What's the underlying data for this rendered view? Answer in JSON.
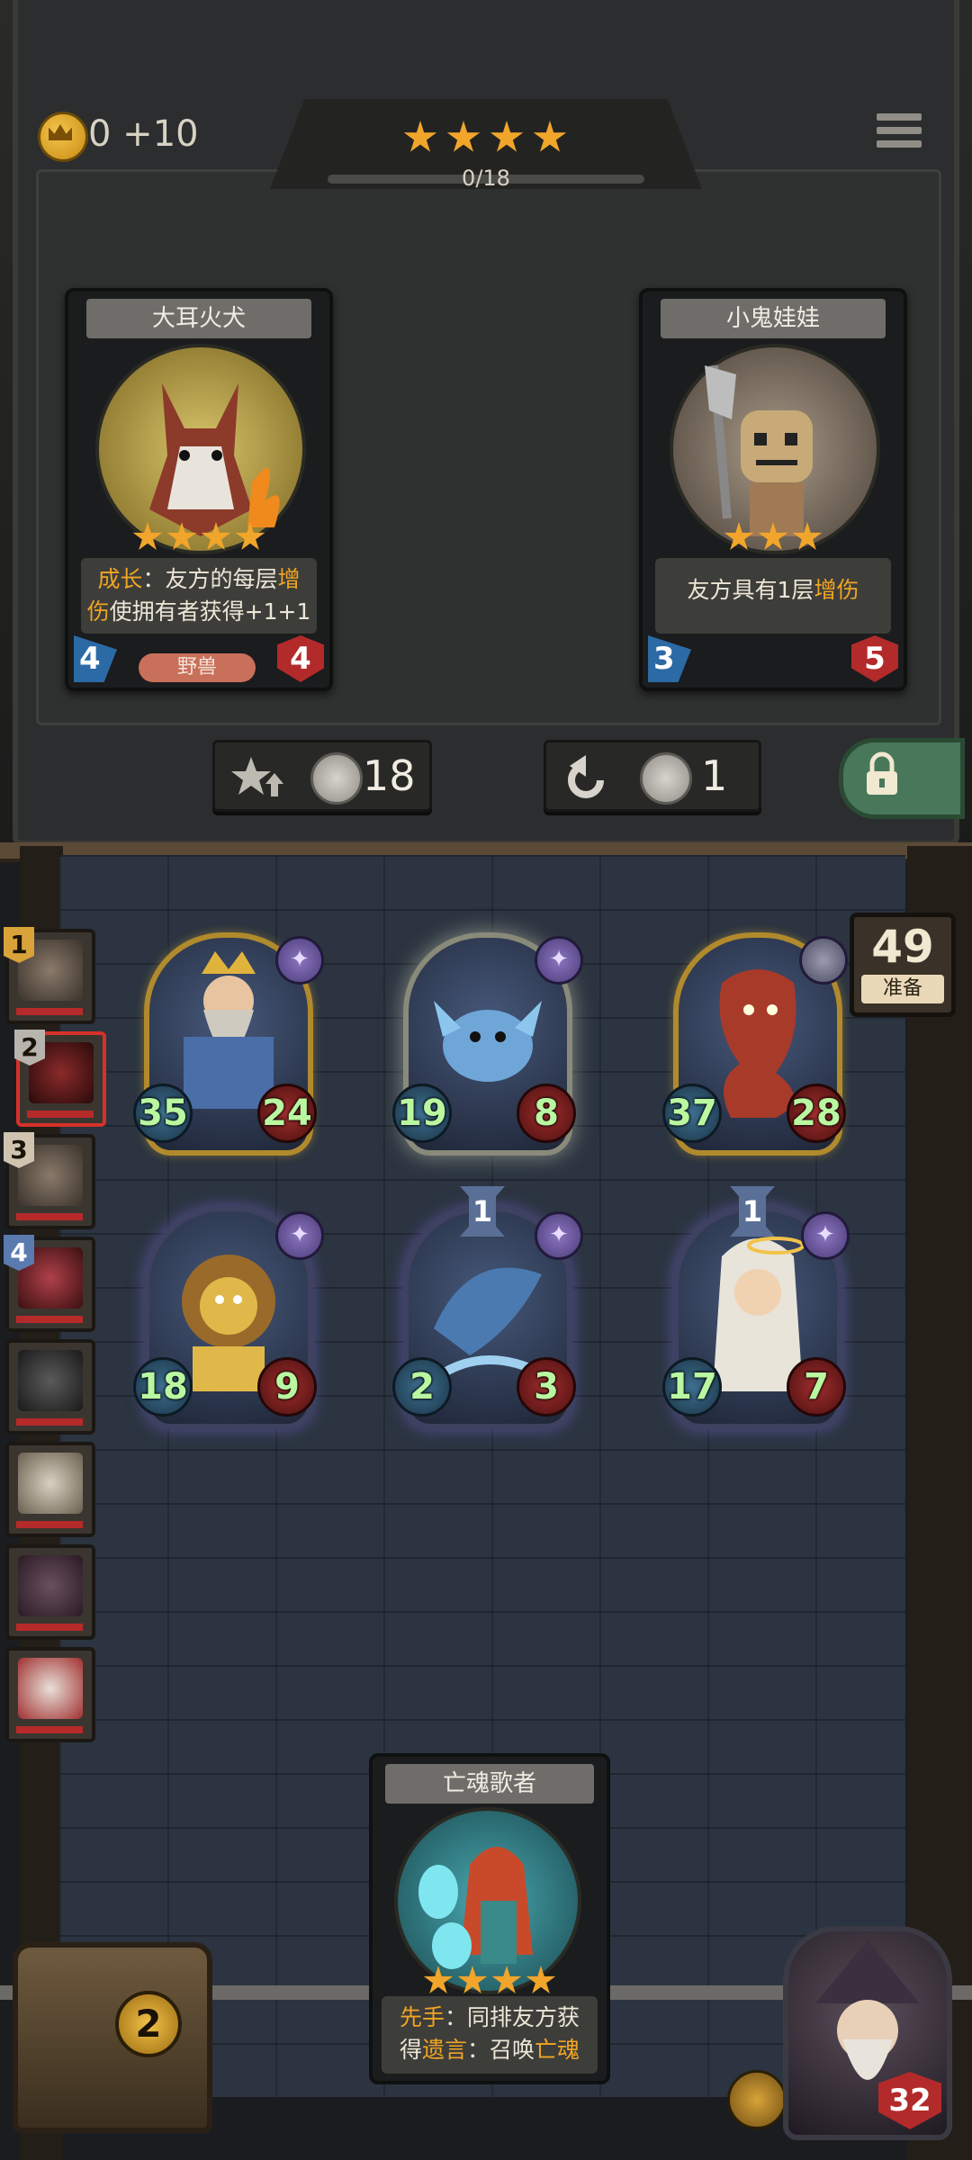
{
  "topbar": {
    "gold": "0",
    "gold_income": "+10",
    "stars": 4,
    "progress_text": "0/18"
  },
  "shop_cards": [
    {
      "name": "大耳火犬",
      "stars": 4,
      "desc_line1_a": "成长",
      "desc_line1_b": "：友方的每层",
      "desc_line1_c": "增",
      "desc_line2_a": "伤",
      "desc_line2_b": "使拥有者获得+1+1",
      "attack": "4",
      "health": "4",
      "tribe": "野兽"
    },
    {
      "name": "小鬼娃娃",
      "stars": 3,
      "desc_a": "友方具有1层",
      "desc_b": "增伤",
      "attack": "3",
      "health": "5",
      "tribe": ""
    }
  ],
  "shop_buttons": {
    "upgrade_cost": "18",
    "refresh_cost": "1"
  },
  "timer": {
    "value": "49",
    "label": "准备"
  },
  "opponents": [
    {
      "rank": "1",
      "selected": false
    },
    {
      "rank": "2",
      "selected": true
    },
    {
      "rank": "3",
      "selected": false
    },
    {
      "rank": "4",
      "selected": false
    },
    {
      "rank": "",
      "selected": false
    },
    {
      "rank": "",
      "selected": false
    },
    {
      "rank": "",
      "selected": false
    },
    {
      "rank": "",
      "selected": false
    }
  ],
  "board": [
    {
      "attack": "35",
      "health": "24",
      "tier": "",
      "gem": "✦"
    },
    {
      "attack": "19",
      "health": "8",
      "tier": "",
      "gem": "✦"
    },
    {
      "attack": "37",
      "health": "28",
      "tier": "",
      "gem": ""
    },
    {
      "attack": "18",
      "health": "9",
      "tier": "",
      "gem": "✦"
    },
    {
      "attack": "2",
      "health": "3",
      "tier": "1",
      "gem": "✦"
    },
    {
      "attack": "17",
      "health": "7",
      "tier": "1",
      "gem": "✦"
    }
  ],
  "hand_card": {
    "name": "亡魂歌者",
    "stars": 4,
    "line1_a": "先手",
    "line1_b": "：同排友方获",
    "line2_a": "得",
    "line2_b": "遗言",
    "line2_c": "：召唤",
    "line2_d": "亡魂"
  },
  "chest": {
    "count": "2"
  },
  "hero": {
    "health": "32"
  },
  "colors": {
    "highlight": "#f0a524",
    "attack_text": "#b9f7a0",
    "health_red": "#b32a2a"
  }
}
